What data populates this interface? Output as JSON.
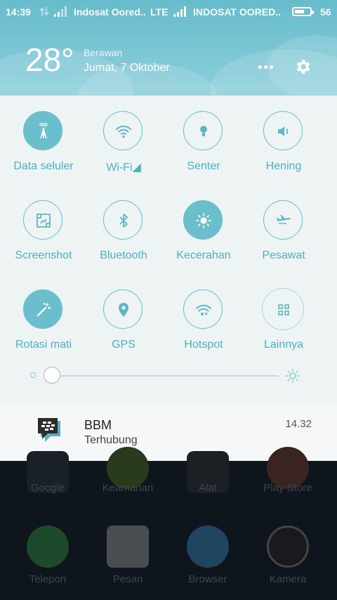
{
  "status_bar": {
    "time": "14:39",
    "carrier1": "Indosat Oored..",
    "network": "LTE",
    "carrier2": "INDOSAT OORED..",
    "battery": "56"
  },
  "weather": {
    "temperature": "28°",
    "condition": "Berawan",
    "date": "Jumat, 7 Oktober"
  },
  "toggles": [
    {
      "label": "Data seluler",
      "icon": "mobile-data-icon",
      "on": true
    },
    {
      "label": "Wi-Fi◢",
      "icon": "wifi-icon",
      "on": false
    },
    {
      "label": "Senter",
      "icon": "flashlight-icon",
      "on": false
    },
    {
      "label": "Hening",
      "icon": "speaker-icon",
      "on": false
    },
    {
      "label": "Screenshot",
      "icon": "screenshot-icon",
      "on": false
    },
    {
      "label": "Bluetooth",
      "icon": "bluetooth-icon",
      "on": false
    },
    {
      "label": "Kecerahan",
      "icon": "brightness-icon",
      "on": true
    },
    {
      "label": "Pesawat",
      "icon": "airplane-icon",
      "on": false
    },
    {
      "label": "Rotasi mati",
      "icon": "rotation-icon",
      "on": true
    },
    {
      "label": "GPS",
      "icon": "location-icon",
      "on": false
    },
    {
      "label": "Hotspot",
      "icon": "hotspot-icon",
      "on": false
    },
    {
      "label": "Lainnya",
      "icon": "grid-icon",
      "on": false
    }
  ],
  "brightness": {
    "level": 0.0
  },
  "notification": {
    "app": "BBM",
    "text": "Terhubung",
    "time": "14.32"
  },
  "home_apps": [
    "Google",
    "Keamanan",
    "Alat",
    "Play Store"
  ],
  "dock_apps": [
    "Telepon",
    "Pesan",
    "Browser",
    "Kamera"
  ],
  "colors": {
    "accent": "#6bbfcc",
    "label": "#4fb0c0"
  }
}
